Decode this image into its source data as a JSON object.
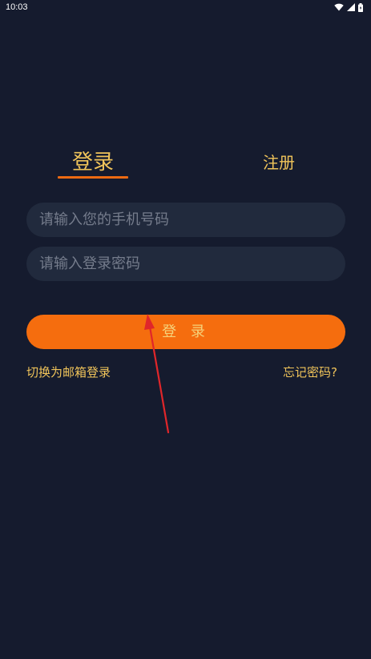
{
  "status_bar": {
    "time": "10:03",
    "icons": [
      "wifi-icon",
      "signal-icon",
      "battery-icon"
    ]
  },
  "tabs": {
    "login_label": "登录",
    "register_label": "注册",
    "active": "login"
  },
  "form": {
    "phone_placeholder": "请输入您的手机号码",
    "phone_value": "",
    "password_placeholder": "请输入登录密码",
    "password_value": ""
  },
  "login_button_label": "登 录",
  "links": {
    "switch_email": "切换为邮箱登录",
    "forgot_password": "忘记密码?"
  },
  "colors": {
    "background": "#151b2e",
    "accent": "#f56d0e",
    "text_accent": "#f0c45a",
    "field_bg": "#212a3d",
    "annotation_arrow": "#e0262a"
  }
}
